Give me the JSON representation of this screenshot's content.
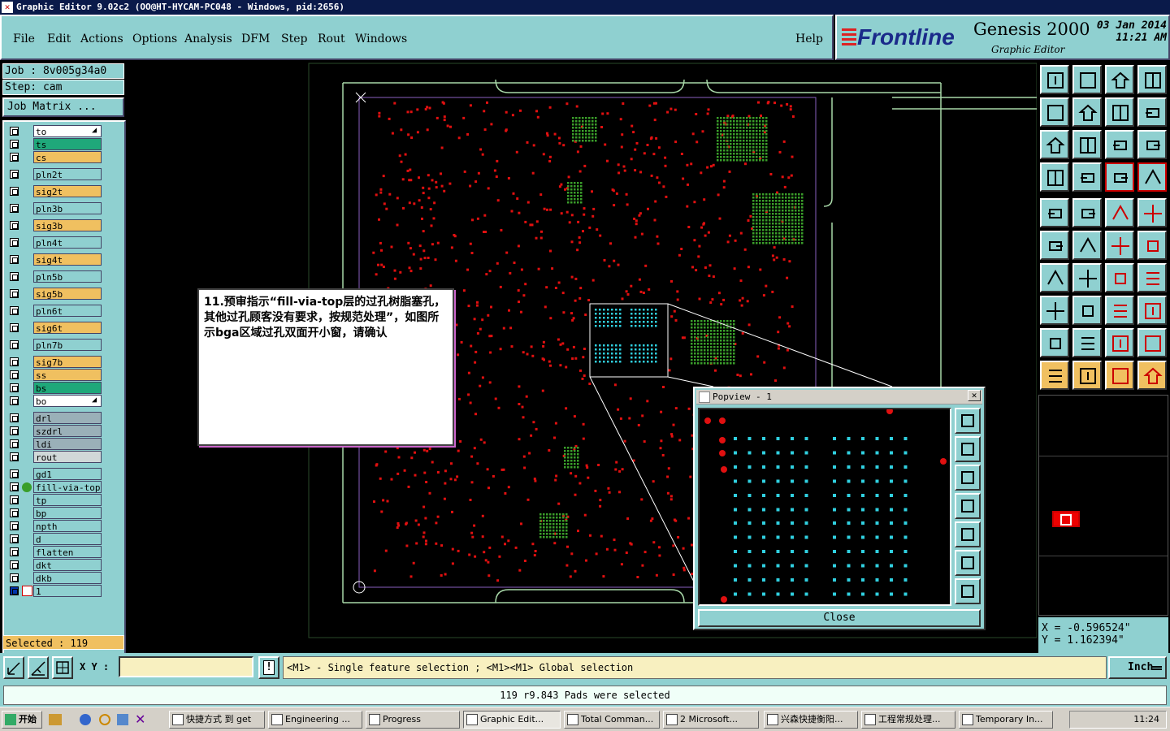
{
  "window": {
    "title": "Graphic Editor 9.02c2 (OO@HT-HYCAM-PC048 - Windows, pid:2656)"
  },
  "menu": {
    "file": "File",
    "edit": "Edit",
    "actions": "Actions",
    "options": "Options",
    "analysis": "Analysis",
    "dfm": "DFM",
    "step": "Step",
    "rout": "Rout",
    "windows": "Windows",
    "help": "Help"
  },
  "brand": {
    "logo": "Frontline",
    "product": "Genesis 2000",
    "subtitle": "Graphic Editor",
    "date": "03 Jan 2014",
    "time": "11:21 AM"
  },
  "job": {
    "job": "Job : 8v005g34a0",
    "step": "Step: cam",
    "matrix_button": "Job Matrix ..."
  },
  "layers": [
    {
      "name": "to",
      "color": "#ffffff",
      "arrow": true
    },
    {
      "name": "ts",
      "color": "#1fa87a"
    },
    {
      "name": "cs",
      "color": "#f0c060"
    },
    {
      "name": "pln2t",
      "color": "#8fd0d0"
    },
    {
      "name": "sig2t",
      "color": "#f0c060"
    },
    {
      "name": "pln3b",
      "color": "#8fd0d0"
    },
    {
      "name": "sig3b",
      "color": "#f0c060"
    },
    {
      "name": "pln4t",
      "color": "#8fd0d0"
    },
    {
      "name": "sig4t",
      "color": "#f0c060"
    },
    {
      "name": "pln5b",
      "color": "#8fd0d0"
    },
    {
      "name": "sig5b",
      "color": "#f0c060"
    },
    {
      "name": "pln6t",
      "color": "#8fd0d0"
    },
    {
      "name": "sig6t",
      "color": "#f0c060"
    },
    {
      "name": "pln7b",
      "color": "#8fd0d0"
    },
    {
      "name": "sig7b",
      "color": "#f0c060"
    },
    {
      "name": "ss",
      "color": "#f0c060"
    },
    {
      "name": "bs",
      "color": "#1fa87a"
    },
    {
      "name": "bo",
      "color": "#ffffff",
      "arrow": true
    },
    {
      "name": "drl",
      "color": "#9ab0b8"
    },
    {
      "name": "szdrl",
      "color": "#9ab0b8"
    },
    {
      "name": "ldi",
      "color": "#9ab0b8"
    },
    {
      "name": "rout",
      "color": "#d0d8d8"
    },
    {
      "name": "gd1",
      "color": "#8fd0d0"
    },
    {
      "name": "fill-via-top",
      "color": "#8fd0d0",
      "active": true
    },
    {
      "name": "tp",
      "color": "#8fd0d0"
    },
    {
      "name": "bp",
      "color": "#8fd0d0"
    },
    {
      "name": "npth",
      "color": "#8fd0d0"
    },
    {
      "name": "d",
      "color": "#8fd0d0"
    },
    {
      "name": "flatten",
      "color": "#8fd0d0"
    },
    {
      "name": "dkt",
      "color": "#8fd0d0"
    },
    {
      "name": "dkb",
      "color": "#8fd0d0"
    },
    {
      "name": "1",
      "color": "#8fd0d0"
    }
  ],
  "selection": {
    "text": "Selected : 119"
  },
  "note": {
    "text": "11.预审指示“fill-via-top层的过孔树脂塞孔，其他过孔顾客没有要求，按规范处理”，如图所示bga区域过孔双面开小窗，请确认"
  },
  "popview": {
    "title": "Popview - 1",
    "close_label": "Close"
  },
  "coords": {
    "x": "X = -0.596524\"",
    "y": "Y = 1.162394\""
  },
  "bottom": {
    "xy_label": "X Y :",
    "xy_value": "",
    "hint": "<M1> - Single feature selection ; <M1><M1> Global selection",
    "unit": "Inch",
    "status": "119 r9.843 Pads were selected"
  },
  "taskbar": {
    "start": "开始",
    "tasks": [
      "快捷方式 到 get",
      "Engineering ...",
      "Progress",
      "Graphic Edit...",
      "Total Comman...",
      "2 Microsoft...",
      "兴森快捷衡阳...",
      "工程常规处理...",
      "Temporary In..."
    ],
    "clock": "11:24"
  },
  "colors": {
    "panel": "#8fd0d0",
    "pad_red": "#e01010",
    "pad_green": "#3a9e2a",
    "pad_cyan": "#30d0e0",
    "outline": "#a8d8a8"
  }
}
